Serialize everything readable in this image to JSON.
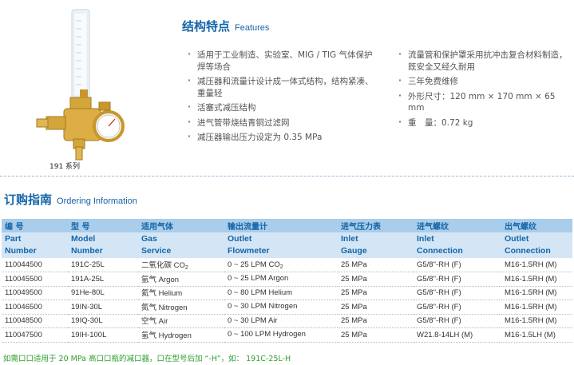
{
  "product": {
    "image_alt": "191系列",
    "caption": "191 系列"
  },
  "features": {
    "title_cn": "结构特点",
    "title_en": "Features",
    "left": [
      "适用于工业制造、实验室、MIG / TIG 气体保护焊等场合",
      "减压器和流量计设计成一体式结构，结构紧凑、重量轻",
      "活塞式减压结构",
      "进气管带烧结青铜过滤网",
      "减压器输出压力设定为 0.35 MPa"
    ],
    "right": [
      "流量管和保护罩采用抗冲击复合材料制造，既安全又经久耐用",
      "三年免费维修",
      "外形尺寸：120 mm × 170 mm × 65 mm",
      "重　量：0.72 kg"
    ]
  },
  "ordering": {
    "title_cn": "订购指南",
    "title_en": "Ordering Information",
    "headers_cn": [
      "编 号",
      "型 号",
      "适用气体",
      "输出流量计",
      "进气压力表",
      "进气螺纹",
      "出气螺纹"
    ],
    "headers_en": [
      [
        "Part",
        "Number"
      ],
      [
        "Model",
        "Number"
      ],
      [
        "Gas",
        "Service"
      ],
      [
        "Outlet",
        "Flowmeter"
      ],
      [
        "Inlet",
        "Gauge"
      ],
      [
        "Inlet",
        "Connection"
      ],
      [
        "Outlet",
        "Connection"
      ]
    ],
    "rows": [
      {
        "part": "110044500",
        "model": "191C-25L",
        "gas_cn": "二氧化碳",
        "gas_en": "CO",
        "gas_sub": "2",
        "flow": "0 ~ 25 LPM CO",
        "flow_sub": "2",
        "gauge": "25 MPa",
        "inlet": "G5/8\"-RH (F)",
        "outlet": "M16-1.5RH (M)"
      },
      {
        "part": "110045500",
        "model": "191A-25L",
        "gas_cn": "氩气",
        "gas_en": "Argon",
        "gas_sub": "",
        "flow": "0 ~ 25 LPM Argon",
        "flow_sub": "",
        "gauge": "25 MPa",
        "inlet": "G5/8\"-RH (F)",
        "outlet": "M16-1.5RH (M)"
      },
      {
        "part": "110049500",
        "model": " 91He-80L",
        "gas_cn": "氦气",
        "gas_en": "Helium",
        "gas_sub": "",
        "flow": "0 ~ 80 LPM Helium",
        "flow_sub": "",
        "gauge": "25 MPa",
        "inlet": "G5/8\"-RH (F)",
        "outlet": "M16-1.5RH (M)"
      },
      {
        "part": "110046500",
        "model": "19IN-30L",
        "gas_cn": "氮气",
        "gas_en": "Nitrogen",
        "gas_sub": "",
        "flow": "0 ~ 30 LPM  Nitrogen",
        "flow_sub": "",
        "gauge": "25 MPa",
        "inlet": "G5/8\"-RH (F)",
        "outlet": "M16-1.5RH (M)"
      },
      {
        "part": "110048500",
        "model": "19IQ-30L",
        "gas_cn": "空气",
        "gas_en": "Air",
        "gas_sub": "",
        "flow": "0 ~ 30 LPM  Air",
        "flow_sub": "",
        "gauge": "25 MPa",
        "inlet": "G5/8\"-RH (F)",
        "outlet": "M16-1.5RH (M)"
      },
      {
        "part": "110047500",
        "model": "19IH-100L",
        "gas_cn": "氢气",
        "gas_en": "Hydrogen",
        "gas_sub": "",
        "flow": "0 ~ 100 LPM  Hydrogen",
        "flow_sub": "",
        "gauge": "25 MPa",
        "inlet": "W21.8-14LH (M)",
        "outlet": "M16-1.5LH (M)"
      }
    ],
    "note": "如需口口适用于 20 MPa 高口口瓶的减口器，口在型号后加 “-H”，如： 191C-25L-H"
  },
  "colors": {
    "accent": "#1565a8",
    "header_dark": "#a9cdea",
    "header_light": "#d4e6f5",
    "note": "#2e9e2e"
  }
}
